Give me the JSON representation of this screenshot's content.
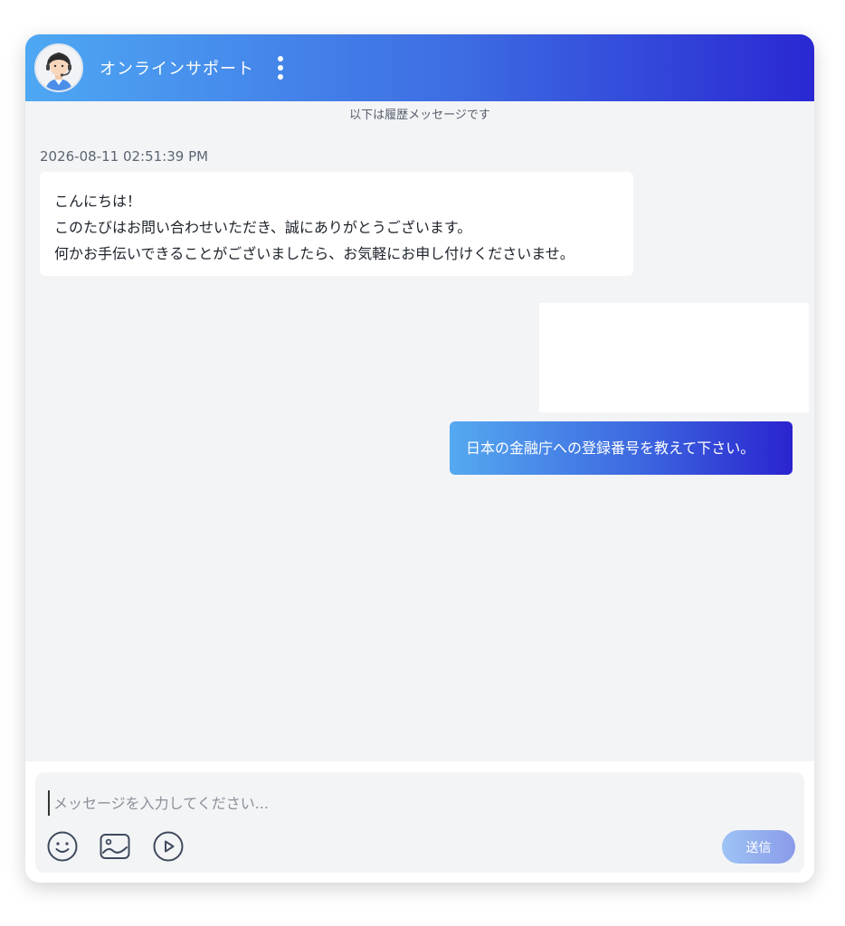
{
  "header": {
    "title": "オンラインサポート",
    "avatar_icon": "support-agent-avatar",
    "menu_icon": "more-vertical-icon"
  },
  "history_note": "以下は履歴メッセージです",
  "messages": [
    {
      "sender": "agent",
      "timestamp": "2026-08-11 02:51:39 PM",
      "lines": [
        "こんにちは！",
        "このたびはお問い合わせいただき、誠にありがとうございます。",
        "何かお手伝いできることがございましたら、お気軽にお申し付けくださいませ。"
      ]
    },
    {
      "sender": "user",
      "type": "image"
    },
    {
      "sender": "user",
      "text": "日本の金融庁への登録番号を教えて下さい。"
    }
  ],
  "composer": {
    "placeholder": "メッセージを入力してください...",
    "value": "",
    "tools": [
      "emoji-icon",
      "image-icon",
      "video-icon"
    ],
    "send_label": "送信"
  },
  "colors": {
    "header_gradient_start": "#4ea8f3",
    "header_gradient_end": "#2a28d2",
    "background": "#f3f4f6",
    "send_button": "#9dc3f5"
  }
}
